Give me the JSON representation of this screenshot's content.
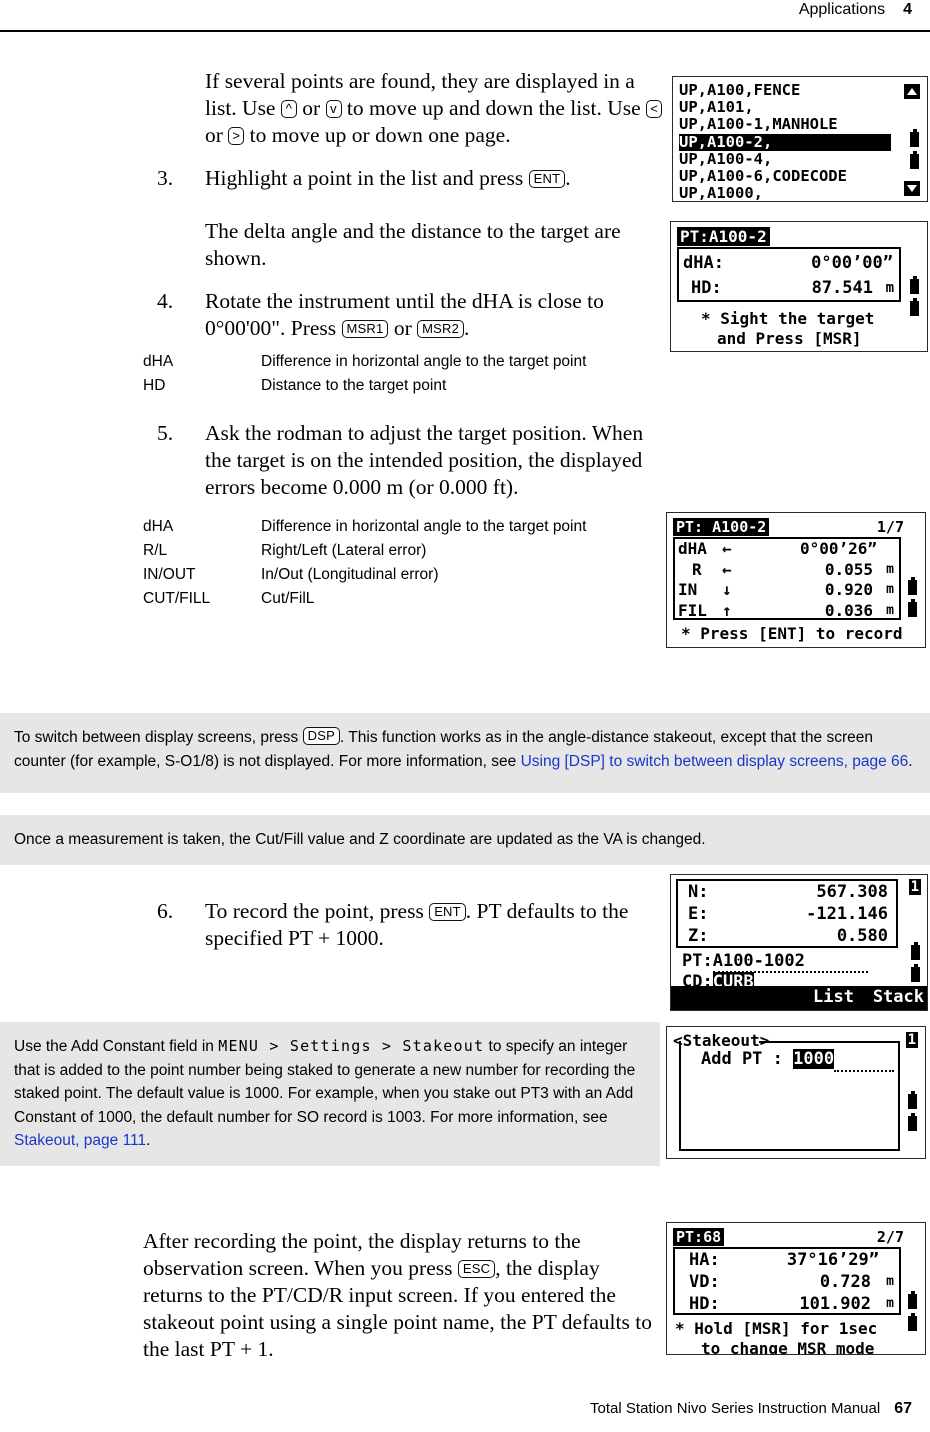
{
  "header": {
    "section": "Applications",
    "chapter": "4"
  },
  "footer": {
    "manual": "Total Station Nivo Series Instruction Manual",
    "page": "67"
  },
  "body": {
    "intro_p1_a": "If several points are found, they are displayed in a list. Use ",
    "key_up": "^",
    "intro_p1_b": " or ",
    "key_down": "v",
    "intro_p1_c": " to move up and down the list. Use ",
    "key_left": "<",
    "intro_p1_d": " or ",
    "key_right": ">",
    "intro_p1_e": " to move up or down one page.",
    "step3_num": "3.",
    "step3_a": "Highlight a point in the list and press ",
    "key_ent": "ENT",
    "step3_b": ".",
    "step3_result": "The delta angle and the distance to the target are shown.",
    "step4_num": "4.",
    "step4_a": "Rotate the instrument until the dHA is close to 0°00'00\". Press ",
    "key_msr1": "MSR1",
    "step4_b": " or ",
    "key_msr2": "MSR2",
    "step4_c": ".",
    "step5_num": "5.",
    "step5_text": "Ask the rodman to adjust the target position. When the target is on the intended position, the displayed errors become 0.000 m (or 0.000 ft).",
    "step6_num": "6.",
    "step6_a": "To record the point, press ",
    "step6_b": ". PT defaults to the specified PT + 1000.",
    "closing_a": "After recording the point, the display returns to the observation screen. When you press ",
    "key_esc": "ESC",
    "closing_b": ", the display returns to the PT/CD/R input screen. If you entered the stakeout point using a single point name, the PT defaults to the last PT + 1."
  },
  "defs1": [
    {
      "term": "dHA",
      "desc": "Difference in horizontal angle to the target point"
    },
    {
      "term": "HD",
      "desc": "Distance to the target point"
    }
  ],
  "defs2": [
    {
      "term": "dHA",
      "desc": "Difference in horizontal angle to the target point"
    },
    {
      "term": "R/L",
      "desc": "Right/Left (Lateral error)"
    },
    {
      "term": "IN/OUT",
      "desc": "In/Out (Longitudinal error)"
    },
    {
      "term": "CUT/FILL",
      "desc": "Cut/FilL"
    }
  ],
  "notes": {
    "note1_a": "To switch between display screens, press ",
    "note1_key": "DSP",
    "note1_b": ". This function works as in the angle-distance stakeout, except that the screen counter (for example, S-O1/8) is not displayed. For more information, see ",
    "note1_link": "Using [DSP] to switch between display screens, page 66",
    "note1_c": ".",
    "note2": "Once a measurement is taken, the Cut/Fill value and Z coordinate are updated as the VA is changed.",
    "note3_a": "Use the Add Constant field in ",
    "note3_path": "MENU > Settings > Stakeout",
    "note3_b": " to specify an integer that is added to the point number being staked to generate a new number for recording the staked point. The default value is 1000. For example, when you stake out PT3 with an Add Constant of 1000, the default number for SO record is 1003. For more information, see ",
    "note3_link": "Stakeout, page 111",
    "note3_c": "."
  },
  "screens": {
    "list": {
      "rows": [
        "UP,A100,FENCE",
        "UP,A101,",
        "UP,A100-1,MANHOLE",
        "UP,A100-2,",
        "UP,A100-4,",
        "UP,A100-6,CODECODE",
        "UP,A1000,"
      ],
      "selected_index": 3
    },
    "delta": {
      "title": "PT:A100-2",
      "rows": [
        {
          "label": "dHA:",
          "value": "0°00’00”",
          "unit": ""
        },
        {
          "label": "HD:",
          "value": "87.541",
          "unit": "m"
        }
      ],
      "msg1": "* Sight the target",
      "msg2": "and Press [MSR]"
    },
    "errors": {
      "title": "PT: A100-2",
      "counter": "1/7",
      "rows": [
        {
          "label": "dHA",
          "dir": "←",
          "value": "0°00’26”",
          "unit": ""
        },
        {
          "label": "R",
          "dir": "←",
          "value": "0.055",
          "unit": "m"
        },
        {
          "label": "IN",
          "dir": "↓",
          "value": "0.920",
          "unit": "m"
        },
        {
          "label": "FIL",
          "dir": "↑",
          "value": "0.036",
          "unit": "m"
        }
      ],
      "msg": "* Press [ENT] to record"
    },
    "record": {
      "rows": [
        {
          "label": "N:",
          "value": "567.308"
        },
        {
          "label": "E:",
          "value": "-121.146"
        },
        {
          "label": "Z:",
          "value": "0.580"
        }
      ],
      "pt_label": "PT:",
      "pt_value": "A100-1002",
      "cd_label": "CD:",
      "cd_value": "CURB",
      "softkey1": "List",
      "softkey2": "Stack",
      "page_badge": "1"
    },
    "stakeout": {
      "title": "<Stakeout>",
      "field_label": "Add PT :",
      "field_value": "1000",
      "page_badge": "1"
    },
    "observation": {
      "title": "PT:68",
      "counter": "2/7",
      "rows": [
        {
          "label": "HA:",
          "value": "37°16’29”",
          "unit": ""
        },
        {
          "label": "VD:",
          "value": "0.728",
          "unit": "m"
        },
        {
          "label": "HD:",
          "value": "101.902",
          "unit": "m"
        }
      ],
      "msg1": "* Hold [MSR] for 1sec",
      "msg2": "to change MSR mode"
    }
  }
}
